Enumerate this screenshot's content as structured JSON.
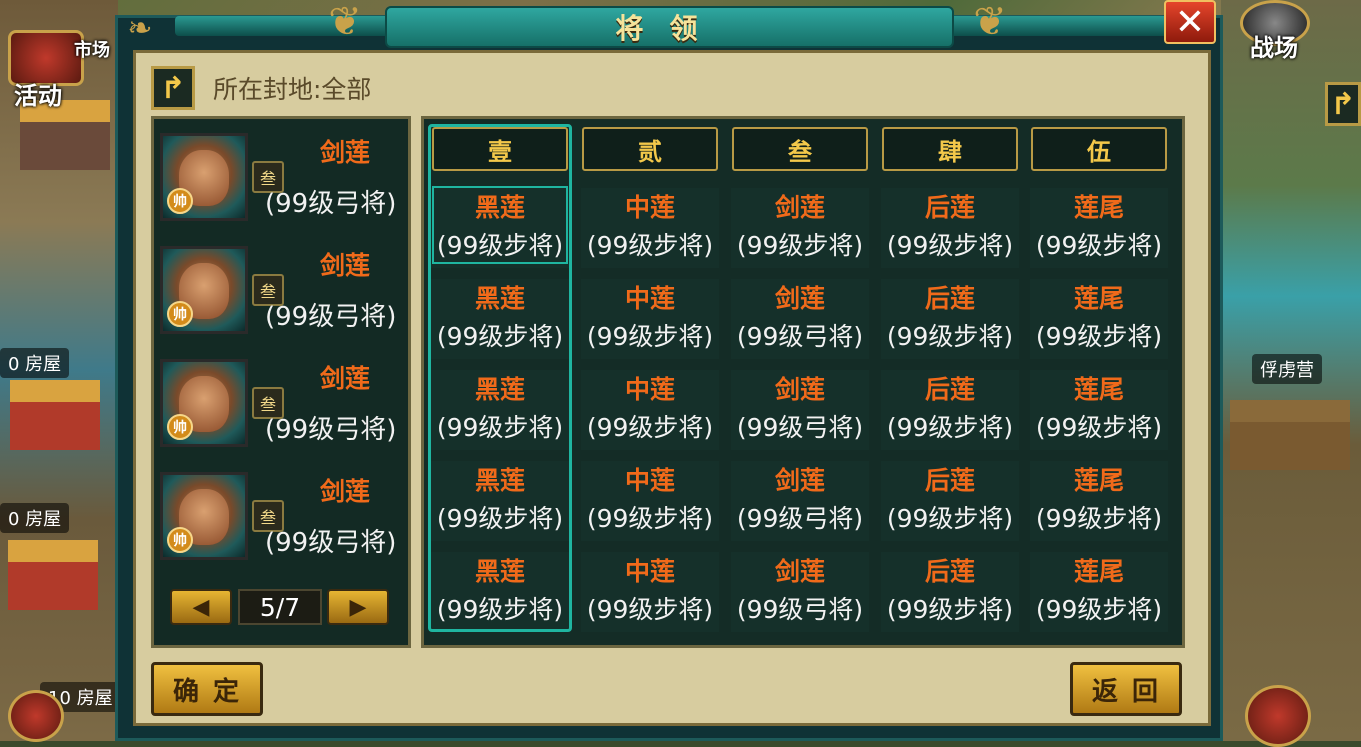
{
  "dialog": {
    "title": "将领",
    "close_label": "✕",
    "fief_label": "所在封地:全部",
    "back_icon": "↱"
  },
  "side": {
    "left_activity": "活动",
    "left_market": "市场",
    "left_houses": [
      "0 房屋",
      "0 房屋",
      "10 房屋"
    ],
    "right_battlefield": "战场",
    "right_camp": "俘虏营"
  },
  "generals": [
    {
      "name": "剑莲",
      "level": "(99级弓将)",
      "star": "叁",
      "badge": "帅"
    },
    {
      "name": "剑莲",
      "level": "(99级弓将)",
      "star": "叁",
      "badge": "帅"
    },
    {
      "name": "剑莲",
      "level": "(99级弓将)",
      "star": "叁",
      "badge": "帅"
    },
    {
      "name": "剑莲",
      "level": "(99级弓将)",
      "star": "叁",
      "badge": "帅"
    }
  ],
  "pager": {
    "prev": "◀",
    "next": "▶",
    "text": "5/7"
  },
  "columns": [
    "壹",
    "贰",
    "叁",
    "肆",
    "伍"
  ],
  "grid": [
    [
      {
        "name": "黑莲",
        "level": "(99级步将)"
      },
      {
        "name": "中莲",
        "level": "(99级步将)"
      },
      {
        "name": "剑莲",
        "level": "(99级步将)"
      },
      {
        "name": "后莲",
        "level": "(99级步将)"
      },
      {
        "name": "莲尾",
        "level": "(99级步将)"
      }
    ],
    [
      {
        "name": "黑莲",
        "level": "(99级步将)"
      },
      {
        "name": "中莲",
        "level": "(99级步将)"
      },
      {
        "name": "剑莲",
        "level": "(99级弓将)"
      },
      {
        "name": "后莲",
        "level": "(99级步将)"
      },
      {
        "name": "莲尾",
        "level": "(99级步将)"
      }
    ],
    [
      {
        "name": "黑莲",
        "level": "(99级步将)"
      },
      {
        "name": "中莲",
        "level": "(99级步将)"
      },
      {
        "name": "剑莲",
        "level": "(99级弓将)"
      },
      {
        "name": "后莲",
        "level": "(99级步将)"
      },
      {
        "name": "莲尾",
        "level": "(99级步将)"
      }
    ],
    [
      {
        "name": "黑莲",
        "level": "(99级步将)"
      },
      {
        "name": "中莲",
        "level": "(99级步将)"
      },
      {
        "name": "剑莲",
        "level": "(99级弓将)"
      },
      {
        "name": "后莲",
        "level": "(99级步将)"
      },
      {
        "name": "莲尾",
        "level": "(99级步将)"
      }
    ],
    [
      {
        "name": "黑莲",
        "level": "(99级步将)"
      },
      {
        "name": "中莲",
        "level": "(99级步将)"
      },
      {
        "name": "剑莲",
        "level": "(99级弓将)"
      },
      {
        "name": "后莲",
        "level": "(99级步将)"
      },
      {
        "name": "莲尾",
        "level": "(99级步将)"
      }
    ]
  ],
  "buttons": {
    "confirm": "确定",
    "back": "返回"
  }
}
